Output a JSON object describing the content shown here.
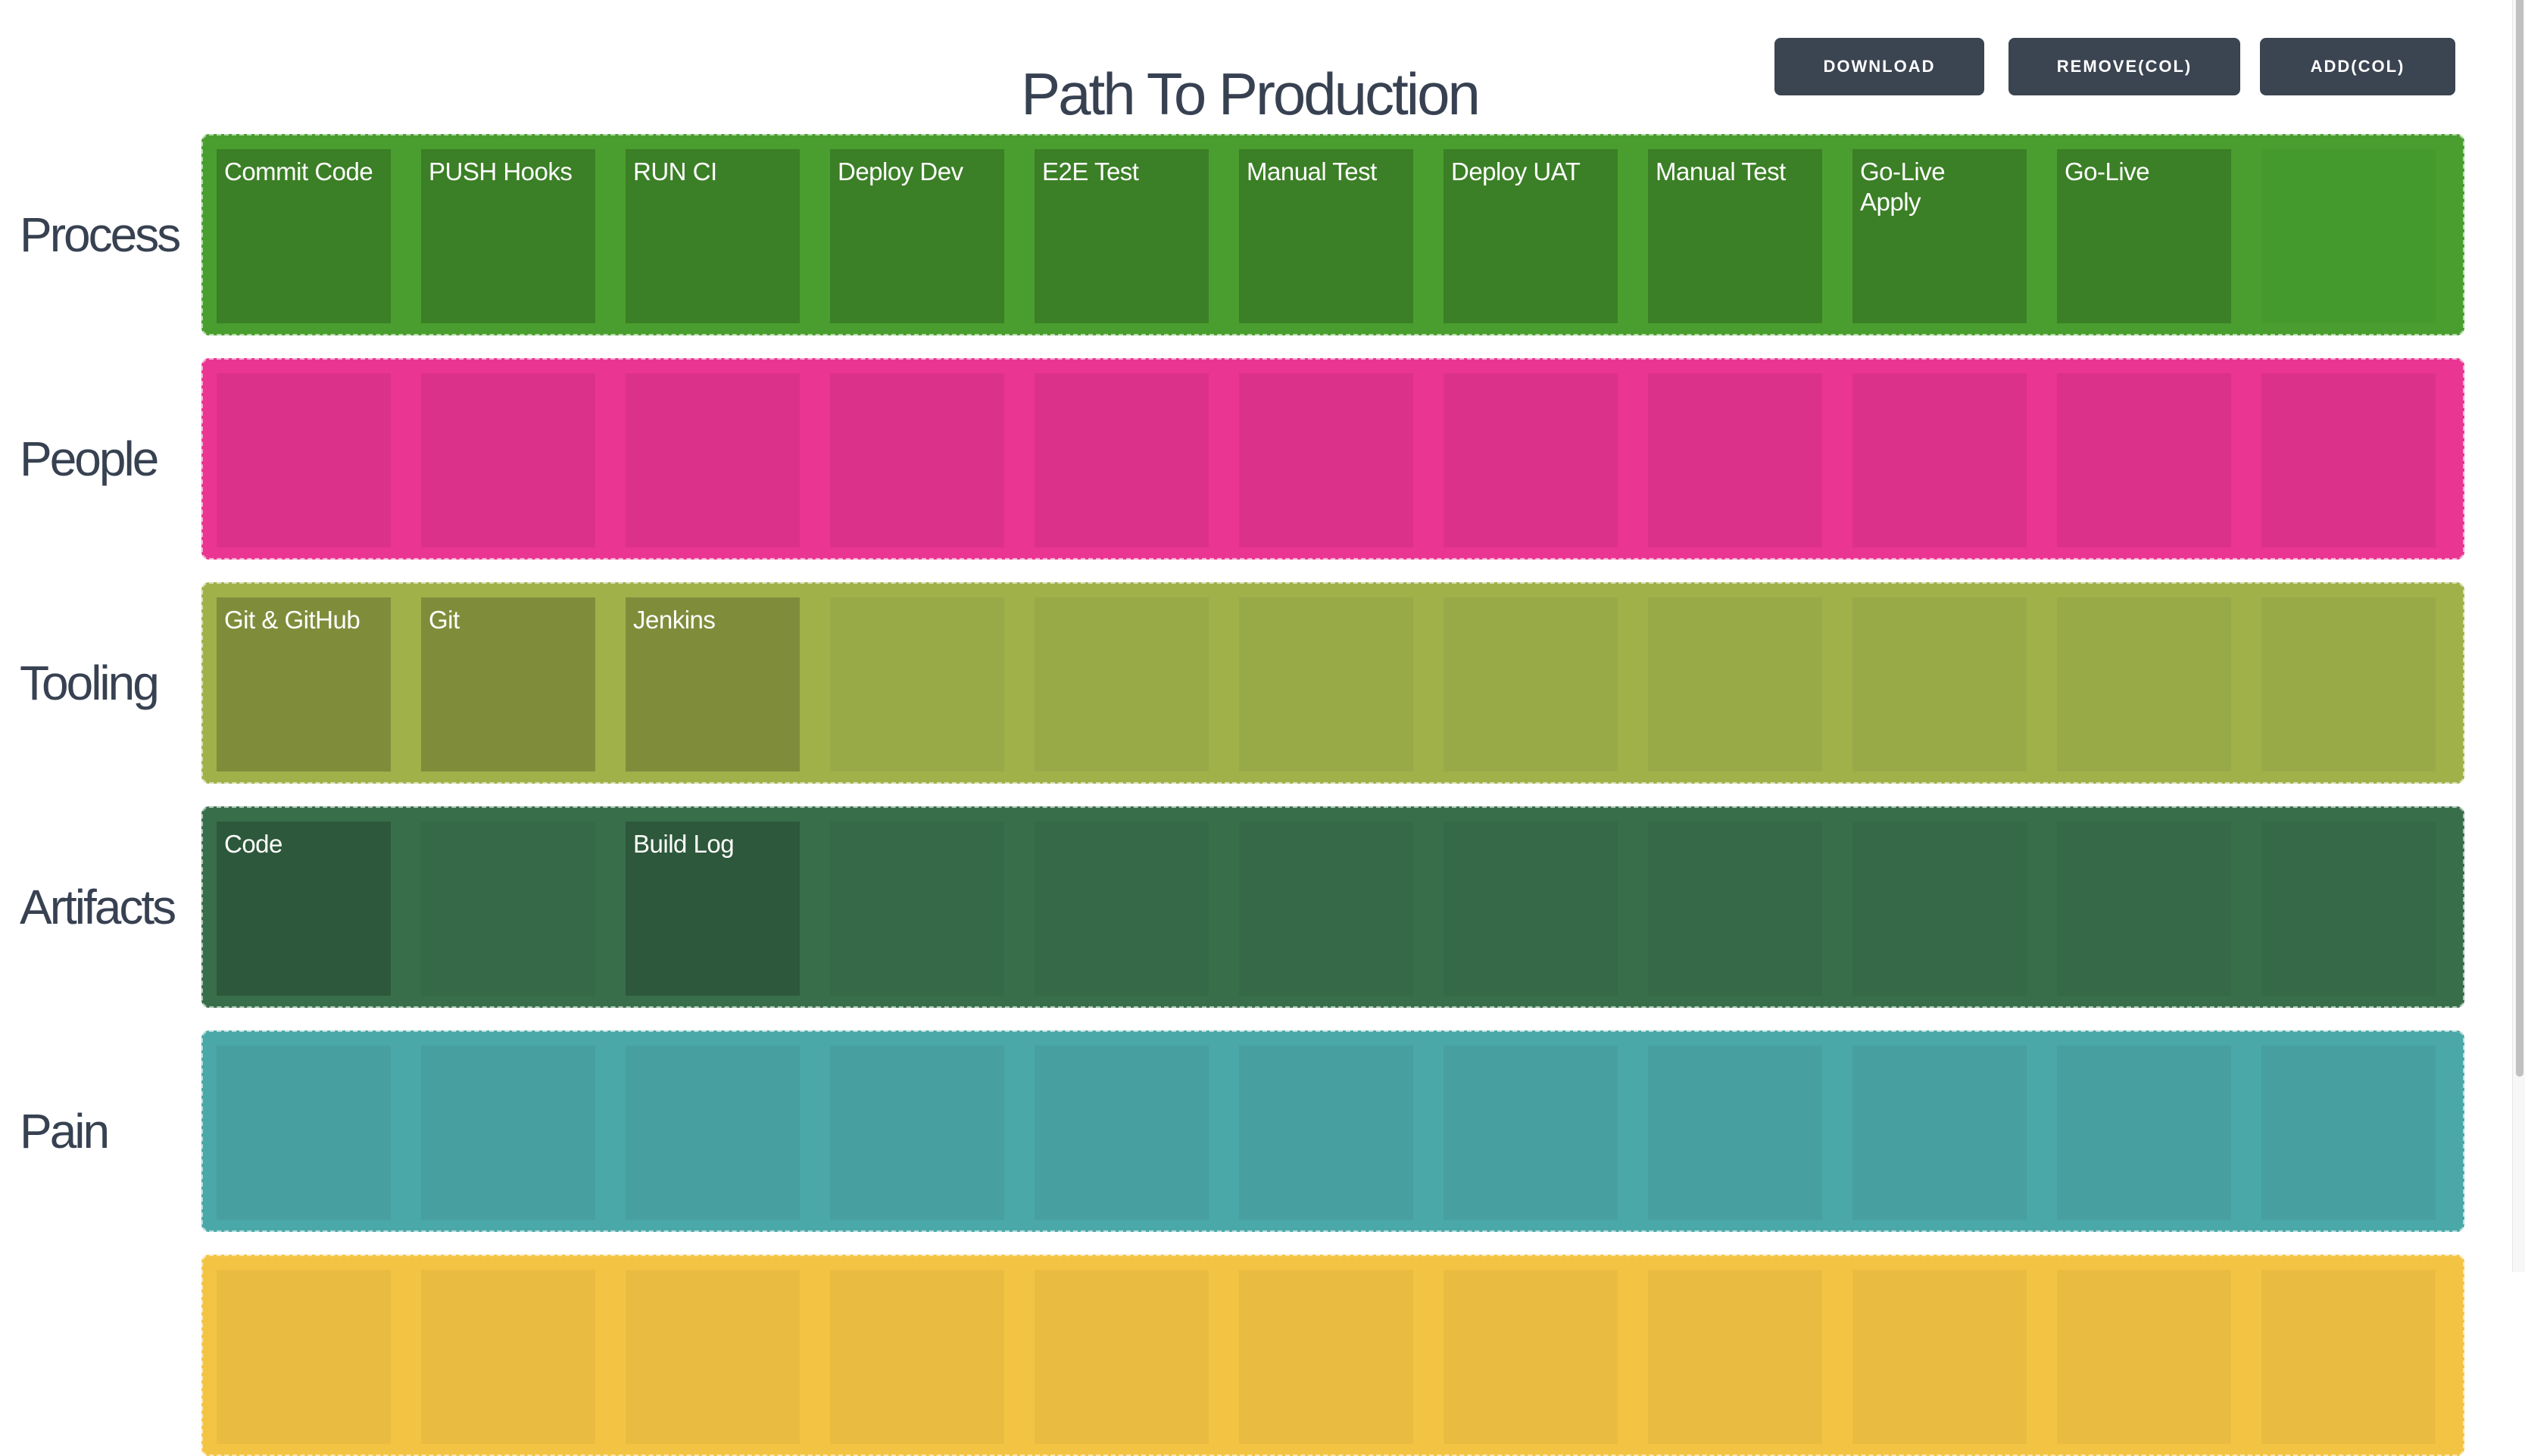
{
  "header": {
    "title": "Path To Production",
    "buttons": {
      "download": "DOWNLOAD",
      "remove_col": "REMOVE(COL)",
      "add_col": "ADD(COL)"
    }
  },
  "colors": {
    "button_bg": "#3b4451",
    "text": "#374151"
  },
  "rows": [
    {
      "label": "Process",
      "row_color": "#4a9e2f",
      "card_filled_color": "#3b7f26",
      "card_empty_color": "#459a2e",
      "cards": [
        "Commit Code",
        "PUSH Hooks",
        "RUN CI",
        "Deploy Dev",
        "E2E Test",
        "Manual Test",
        "Deploy UAT",
        "Manual Test",
        "Go-Live\nApply",
        "Go-Live",
        ""
      ]
    },
    {
      "label": "People",
      "row_color": "#ea3592",
      "card_filled_color": "#c92c7d",
      "card_empty_color": "#dc318a",
      "cards": [
        "",
        "",
        "",
        "",
        "",
        "",
        "",
        "",
        "",
        "",
        ""
      ]
    },
    {
      "label": "Tooling",
      "row_color": "#a0b14a",
      "card_filled_color": "#7f8d3b",
      "card_empty_color": "#98a948",
      "cards": [
        "Git & GitHub",
        "Git",
        "Jenkins",
        "",
        "",
        "",
        "",
        "",
        "",
        "",
        ""
      ]
    },
    {
      "label": "Artifacts",
      "row_color": "#386f4a",
      "card_filled_color": "#2d583b",
      "card_empty_color": "#366947",
      "cards": [
        "Code",
        "",
        "Build Log",
        "",
        "",
        "",
        "",
        "",
        "",
        "",
        ""
      ]
    },
    {
      "label": "Pain",
      "row_color": "#4aa8a8",
      "card_filled_color": "#3c8a8a",
      "card_empty_color": "#479f9f",
      "cards": [
        "",
        "",
        "",
        "",
        "",
        "",
        "",
        "",
        "",
        "",
        ""
      ]
    },
    {
      "label": "",
      "row_color": "#f3c444",
      "card_filled_color": "#d9ae3b",
      "card_empty_color": "#e9bc41",
      "cards": [
        "",
        "",
        "",
        "",
        "",
        "",
        "",
        "",
        "",
        "",
        ""
      ]
    }
  ]
}
